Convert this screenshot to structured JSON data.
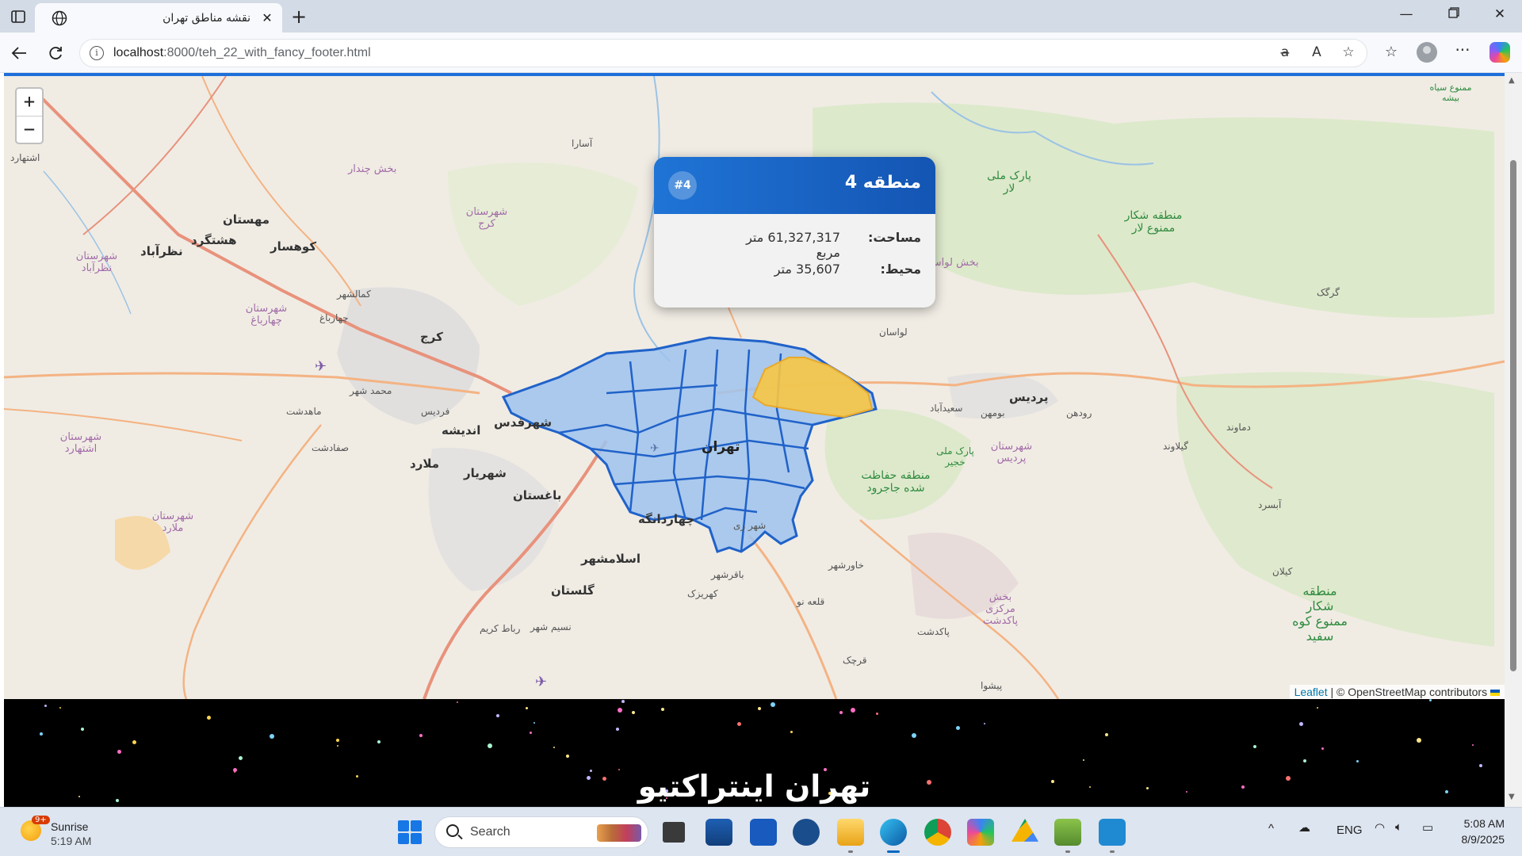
{
  "browser": {
    "tab_title": "نقشه مناطق تهران",
    "url_host": "localhost",
    "url_path": ":8000/teh_22_with_fancy_footer.html"
  },
  "map": {
    "zoom_in": "+",
    "zoom_out": "−",
    "attribution_link": "Leaflet",
    "attribution_text": " | © OpenStreetMap contributors",
    "labels": {
      "karaj": "کرج",
      "tehran": "تهران",
      "shahriar": "شهریار",
      "andisheh": "اندیشه",
      "shahr_qods": "شهرقدس",
      "baghestan": "باغستان",
      "chahardangeh": "چهاردانگه",
      "eslamshahr": "اسلامشهر",
      "golestan": "گلستان",
      "pardis": "پردیس",
      "lavasan": "لواسان",
      "mehestan": "مهستان",
      "hashtgerd": "هشتگرد",
      "nazarabad": "نظرآباد",
      "kouhsar": "کوهسار",
      "malard": "ملارد",
      "shahr_rey": "شهر ری",
      "saeedabad": "سعیدآباد",
      "rudehen": "رودهن",
      "boumehen": "بومهن",
      "park_lar": "پارک ملی لار",
      "lar_reserve": "منطقه شکار ممنوع لار",
      "jajrood": "منطقه حفاظت شده جاجرود",
      "khojir": "پارک ملی خجیر",
      "kooh_sefid": "منطقه شکار ممنوع کوه سفید",
      "siah_bisheh": "ممنوع سیاه بیشه",
      "pardis_county": "شهرستان پردیس",
      "malard_county": "شهرستان ملارد",
      "nazarabad_county": "شهرستان نظرآباد",
      "chaharbagh_county": "شهرستان چهارباغ",
      "eshtehard_county": "شهرستان اشتهارد",
      "karaj_county": "شهرستان کرج",
      "damavand": "دماوند",
      "gilavand": "گیلاوند",
      "absard": "آبسرد",
      "kilan": "کیلان",
      "gorgak": "گرگک",
      "pakdasht": "پاکدشت",
      "ghachak": "قرچک",
      "varamin_area": "بخش مرکزی پاکدشت",
      "chaharbagh": "چهارباغ",
      "kamalshahr": "کمالشهر",
      "mohammadshahr": "محمد شهر",
      "mahdasht": "ماهدشت",
      "fardis": "فردیس",
      "safadasht": "صفادشت",
      "golestan2": "رباط کریم",
      "nasimshahr": "نسیم شهر",
      "baqershahr": "باقرشهر",
      "kahrizak": "کهریزک",
      "khavarshahr": "خاورشهر",
      "qaleh_now": "قلعه نو",
      "pishva": "پیشوا",
      "bumehen_dist": "بخش لواسانات",
      "tarbiat": "بخش چندار",
      "asara": "آسارا",
      "ashtehard": "اشتهارد"
    }
  },
  "popup": {
    "title": "منطقه 4",
    "badge": "#4",
    "area_label": "مساحت:",
    "area_value": "61,327,317 متر مربع",
    "perimeter_label": "محیط:",
    "perimeter_value": "35,607 متر"
  },
  "footer": {
    "title": "تهران اینتراکتیو"
  },
  "taskbar": {
    "weather_name": "Sunrise",
    "weather_time": "5:19 AM",
    "weather_badge": "9+",
    "search_placeholder": "Search",
    "lang": "ENG",
    "time": "5:08 AM",
    "date": "8/9/2025"
  },
  "colors": {
    "district_fill": "#9ec3ee",
    "district_stroke": "#2062c9",
    "highlight_fill": "#f7c542",
    "popup_header": "#1f74d6"
  }
}
